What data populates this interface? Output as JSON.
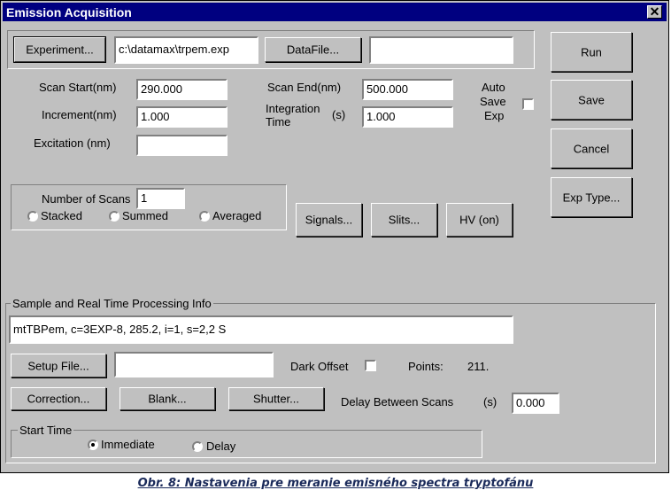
{
  "window": {
    "title": "Emission Acquisition",
    "close_glyph": "✕"
  },
  "top": {
    "experiment_button": "Experiment...",
    "experiment_path": "c:\\datamax\\trpem.exp",
    "datafile_button": "DataFile...",
    "datafile_value": ""
  },
  "side_buttons": {
    "run": "Run",
    "save": "Save",
    "cancel": "Cancel",
    "exp_type": "Exp Type..."
  },
  "scan": {
    "start_label": "Scan Start(nm)",
    "start_value": "290.000",
    "end_label": "Scan End(nm)",
    "end_value": "500.000",
    "increment_label": "Increment(nm)",
    "increment_value": "1.000",
    "integration_label_1": "Integration",
    "integration_label_2": "Time",
    "integration_unit": "(s)",
    "integration_value": "1.000",
    "excitation_label": "Excitation (nm)",
    "excitation_value": "",
    "auto_save_1": "Auto",
    "auto_save_2": "Save",
    "auto_save_3": "Exp",
    "auto_save_checked": false
  },
  "scans": {
    "number_label": "Number of Scans",
    "number_value": "1",
    "options": [
      "Stacked",
      "Summed",
      "Averaged"
    ],
    "selected": null
  },
  "mid_buttons": {
    "signals": "Signals...",
    "slits": "Slits...",
    "hv": "HV (on)"
  },
  "sample": {
    "group_label": "Sample and Real Time Processing Info",
    "info_value": "mtTBPem, c=3EXP-8, 285.2, i=1,  s=2,2 S",
    "setup_file_button": "Setup File...",
    "setup_file_value": "",
    "dark_offset_label": "Dark Offset",
    "dark_offset_checked": false,
    "points_label": "Points:",
    "points_value": "211.",
    "correction_button": "Correction...",
    "blank_button": "Blank...",
    "shutter_button": "Shutter...",
    "delay_label": "Delay Between Scans",
    "delay_unit": "(s)",
    "delay_value": "0.000"
  },
  "start_time": {
    "group_label": "Start Time",
    "immediate": "Immediate",
    "delay": "Delay",
    "selected": "Immediate"
  },
  "caption": "Obr. 8: Nastavenia pre meranie emisného spectra tryptofánu"
}
